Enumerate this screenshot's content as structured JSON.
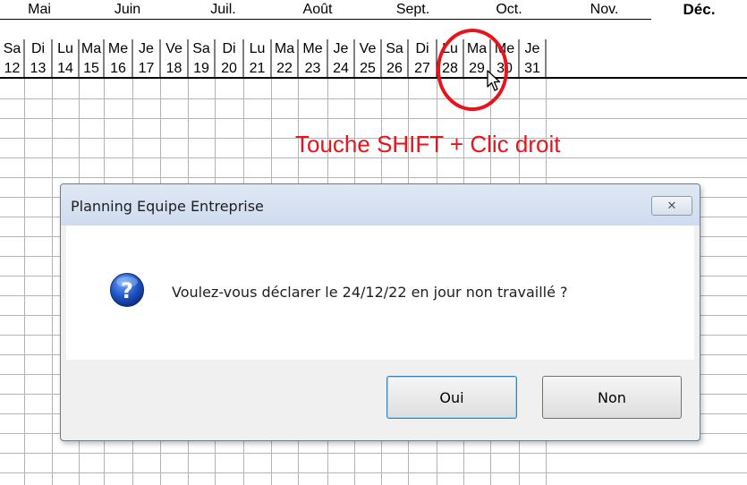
{
  "tabs": [
    {
      "label": "Mai",
      "active": false
    },
    {
      "label": "Juin",
      "active": false
    },
    {
      "label": "Juil.",
      "active": false
    },
    {
      "label": "Août",
      "active": false
    },
    {
      "label": "Sept.",
      "active": false
    },
    {
      "label": "Oct.",
      "active": false
    },
    {
      "label": "Nov.",
      "active": false
    },
    {
      "label": "Déc.",
      "active": true
    }
  ],
  "days": [
    {
      "abbr": "Sa",
      "num": "12"
    },
    {
      "abbr": "Di",
      "num": "13"
    },
    {
      "abbr": "Lu",
      "num": "14"
    },
    {
      "abbr": "Ma",
      "num": "15"
    },
    {
      "abbr": "Me",
      "num": "16"
    },
    {
      "abbr": "Je",
      "num": "17"
    },
    {
      "abbr": "Ve",
      "num": "18"
    },
    {
      "abbr": "Sa",
      "num": "19"
    },
    {
      "abbr": "Di",
      "num": "20"
    },
    {
      "abbr": "Lu",
      "num": "21"
    },
    {
      "abbr": "Ma",
      "num": "22"
    },
    {
      "abbr": "Me",
      "num": "23"
    },
    {
      "abbr": "Je",
      "num": "24"
    },
    {
      "abbr": "Ve",
      "num": "25"
    },
    {
      "abbr": "Sa",
      "num": "26"
    },
    {
      "abbr": "Di",
      "num": "27"
    },
    {
      "abbr": "Lu",
      "num": "28"
    },
    {
      "abbr": "Ma",
      "num": "29"
    },
    {
      "abbr": "Me",
      "num": "30"
    },
    {
      "abbr": "Je",
      "num": "31"
    }
  ],
  "annotation": {
    "text": "Touche SHIFT + Clic droit",
    "color": "#e8131b"
  },
  "dialog": {
    "title": "Planning Equipe Entreprise",
    "message": "Voulez-vous déclarer le 24/12/22 en jour non travaillé ?",
    "close_label": "✕",
    "ok_label": "Oui",
    "cancel_label": "Non",
    "icon": "question-icon"
  }
}
